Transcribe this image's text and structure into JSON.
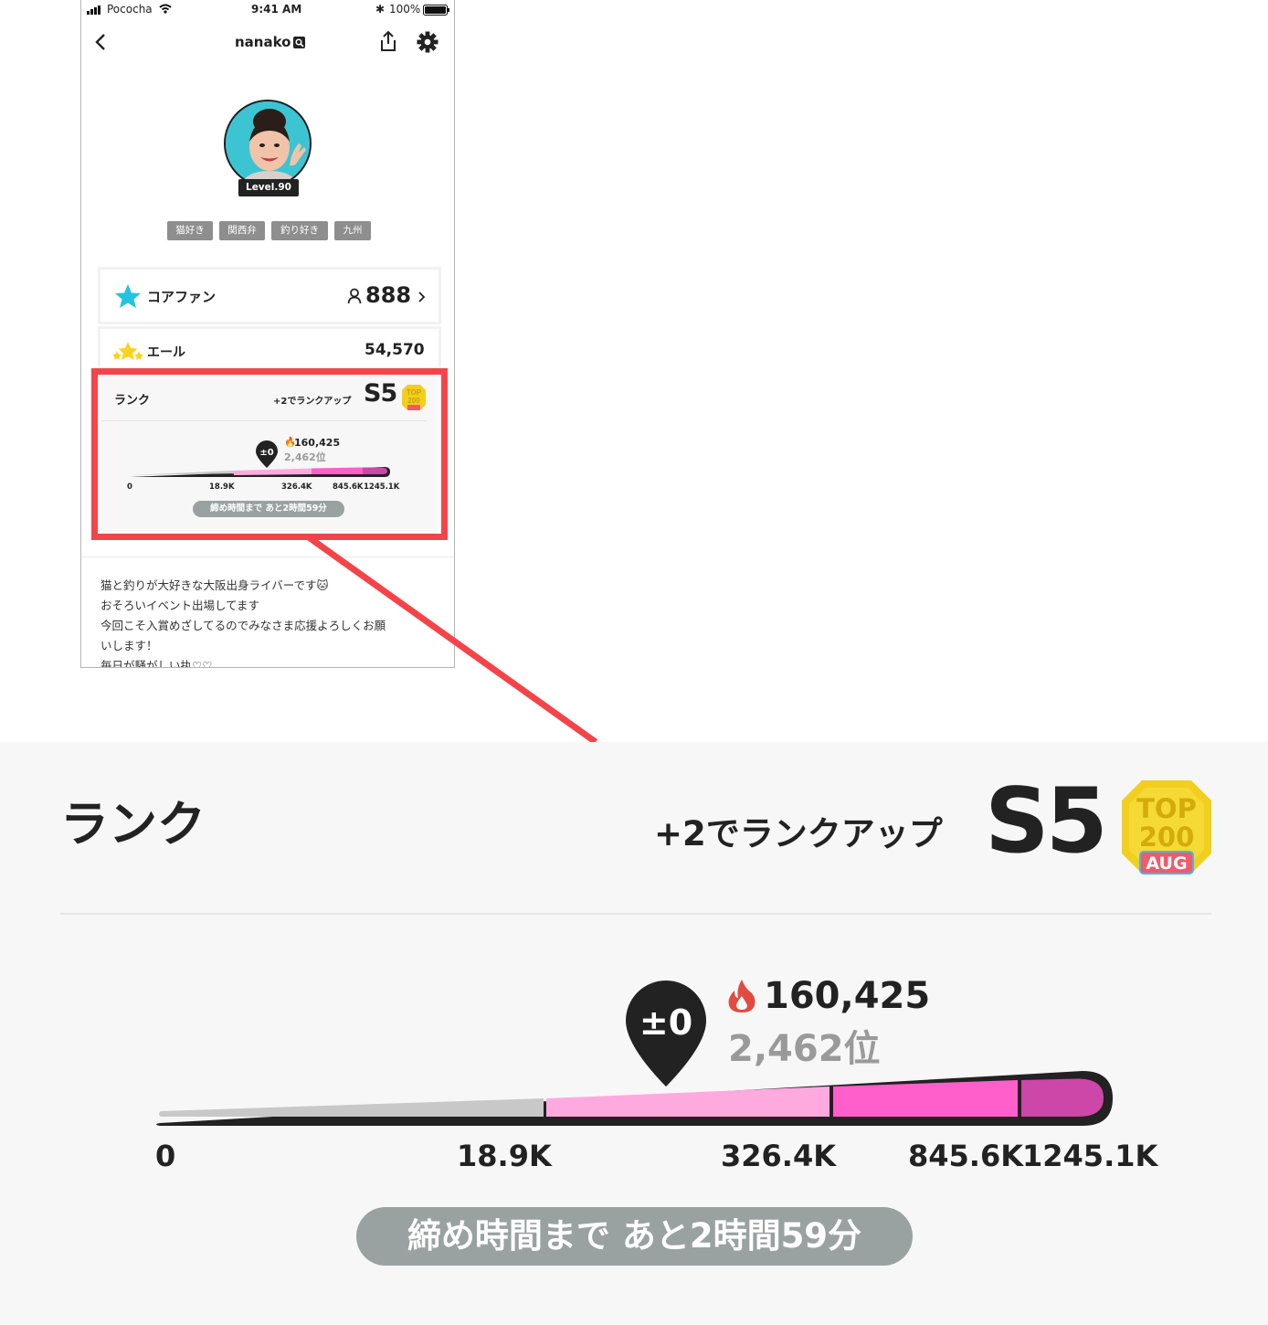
{
  "status_bar": {
    "carrier": "Pococha",
    "time": "9:41 AM",
    "battery": "100%"
  },
  "header": {
    "username": "nanako"
  },
  "profile": {
    "level": "Level.90",
    "tags": [
      "猫好き",
      "関西弁",
      "釣り好き",
      "九州"
    ]
  },
  "core_fan": {
    "label": "コアファン",
    "count": "888"
  },
  "yell": {
    "label": "エール",
    "value": "54,570"
  },
  "rank": {
    "title": "ランク",
    "rank_up_text": "+2でランクアップ",
    "rank_value": "S5",
    "badge": {
      "line1": "TOP",
      "line2": "200",
      "month": "AUG"
    },
    "marker": "±0",
    "score": "160,425",
    "place": "2,462位",
    "ticks": [
      "0",
      "18.9K",
      "326.4K",
      "845.6K",
      "1245.1K"
    ],
    "deadline": "締め時間まで あと2時間59分"
  },
  "bio_lines": [
    "猫と釣りが大好きな大阪出身ライバーです🐱",
    "おそろいイベント出場してます",
    "今回こそ入賞めざしてるのでみなさま応援よろしくお願",
    "いします！",
    "毎日が騒がしい执♡♡"
  ],
  "colors": {
    "highlight": "#f44449",
    "segment_gray": "#c8c8c8",
    "segment_light_pink": "#ffaadf",
    "segment_pink": "#ff5fcb",
    "segment_magenta": "#cc47a8",
    "badge_gold": "#f2cf1f",
    "star_cyan": "#22c4e0",
    "star_yellow": "#ffd11a"
  }
}
